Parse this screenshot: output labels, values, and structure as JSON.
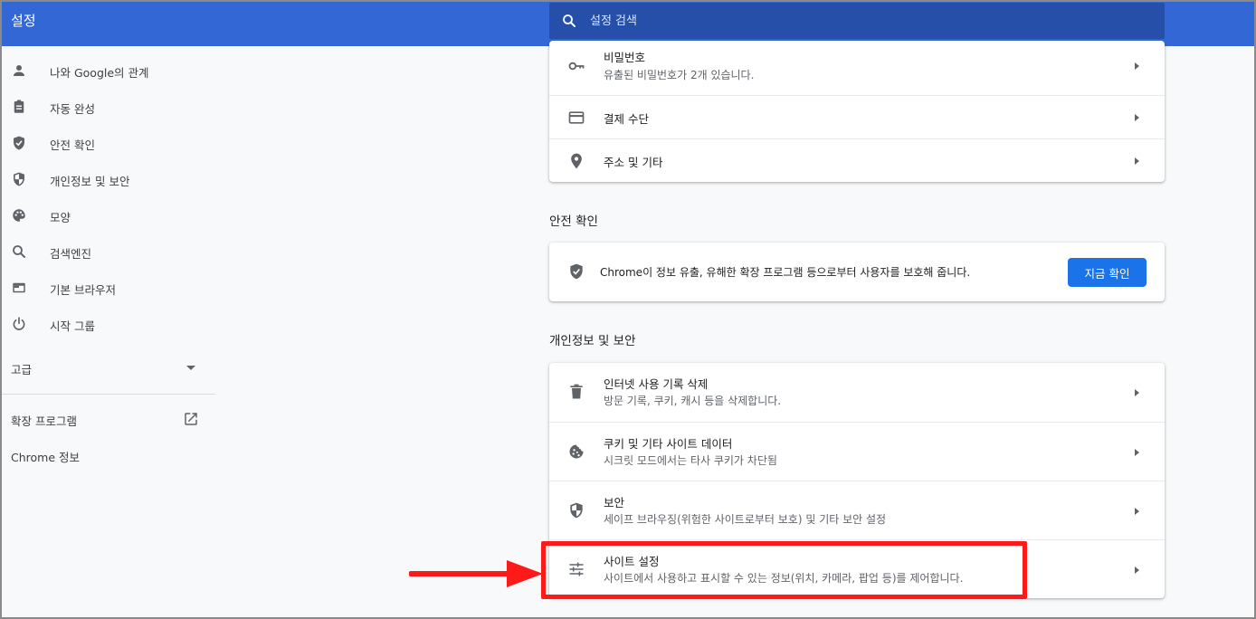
{
  "header": {
    "title": "설정",
    "search_placeholder": "설정 검색"
  },
  "sidebar": {
    "items": [
      {
        "label": "나와 Google의 관계",
        "icon": "person-icon"
      },
      {
        "label": "자동 완성",
        "icon": "clipboard-icon"
      },
      {
        "label": "안전 확인",
        "icon": "shield-check-icon"
      },
      {
        "label": "개인정보 및 보안",
        "icon": "shield-half-icon"
      },
      {
        "label": "모양",
        "icon": "palette-icon"
      },
      {
        "label": "검색엔진",
        "icon": "search-icon"
      },
      {
        "label": "기본 브라우저",
        "icon": "browser-icon"
      },
      {
        "label": "시작 그룹",
        "icon": "power-icon"
      }
    ],
    "advanced_label": "고급",
    "extensions_label": "확장 프로그램",
    "about_label": "Chrome 정보"
  },
  "autofill_card": {
    "rows": [
      {
        "title": "비밀번호",
        "subtitle": "유출된 비밀번호가 2개 있습니다.",
        "icon": "key-icon"
      },
      {
        "title": "결제 수단",
        "icon": "credit-card-icon"
      },
      {
        "title": "주소 및 기타",
        "icon": "location-pin-icon"
      }
    ]
  },
  "safety_check": {
    "section_title": "안전 확인",
    "text": "Chrome이 정보 유출, 유해한 확장 프로그램 등으로부터 사용자를 보호해 줍니다.",
    "button_label": "지금 확인"
  },
  "privacy": {
    "section_title": "개인정보 및 보안",
    "rows": [
      {
        "title": "인터넷 사용 기록 삭제",
        "subtitle": "방문 기록, 쿠키, 캐시 등을 삭제합니다.",
        "icon": "trash-icon"
      },
      {
        "title": "쿠키 및 기타 사이트 데이터",
        "subtitle": "시크릿 모드에서는 타사 쿠키가 차단됨",
        "icon": "cookie-icon"
      },
      {
        "title": "보안",
        "subtitle": "세이프 브라우징(위험한 사이트로부터 보호) 및 기타 보안 설정",
        "icon": "shield-half-icon"
      },
      {
        "title": "사이트 설정",
        "subtitle": "사이트에서 사용하고 표시할 수 있는 정보(위치, 카메라, 팝업 등)를 제어합니다.",
        "icon": "tune-icon"
      }
    ]
  },
  "colors": {
    "header_bg": "#3367d6",
    "search_bg": "#254fa9",
    "accent": "#1a73e8",
    "annotation": "#ff1a1a"
  }
}
